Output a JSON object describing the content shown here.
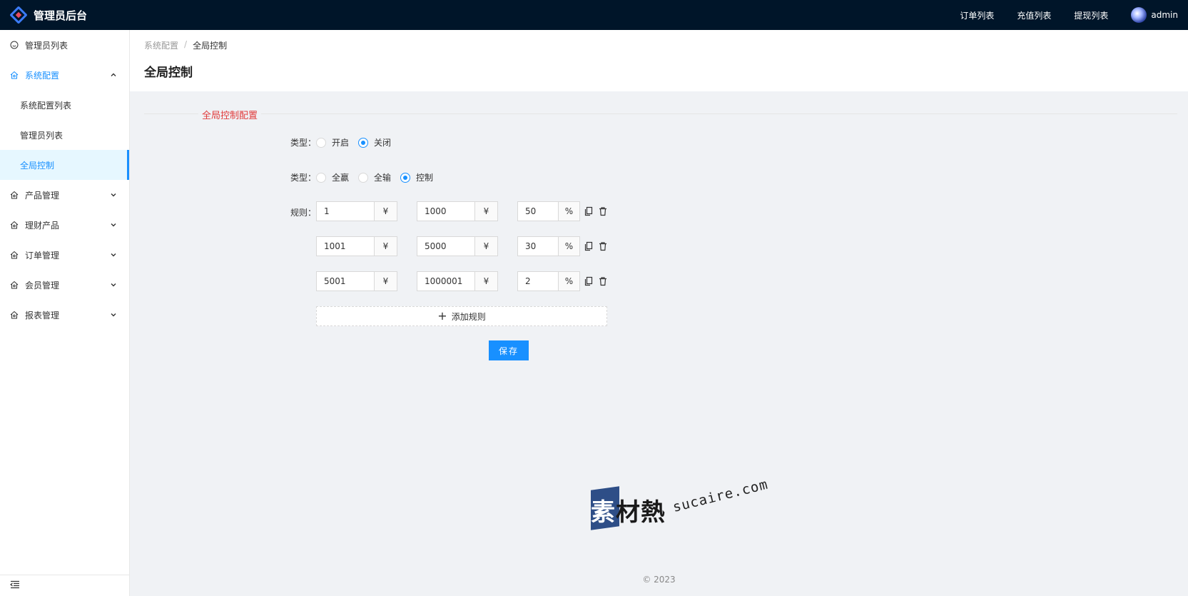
{
  "header": {
    "title": "管理员后台",
    "nav": [
      "订单列表",
      "充值列表",
      "提现列表"
    ],
    "user": "admin",
    "accent": "#001529"
  },
  "sidebar": {
    "items": [
      {
        "label": "管理员列表",
        "icon": "smile-icon"
      },
      {
        "label": "系统配置",
        "icon": "home-icon",
        "open": true,
        "children": [
          {
            "label": "系统配置列表"
          },
          {
            "label": "管理员列表"
          },
          {
            "label": "全局控制",
            "active": true
          }
        ]
      },
      {
        "label": "产品管理",
        "icon": "home-icon"
      },
      {
        "label": "理财产品",
        "icon": "home-icon"
      },
      {
        "label": "订单管理",
        "icon": "home-icon"
      },
      {
        "label": "会员管理",
        "icon": "home-icon"
      },
      {
        "label": "报表管理",
        "icon": "home-icon"
      }
    ],
    "active_color": "#1890ff"
  },
  "page": {
    "breadcrumb": [
      "系统配置",
      "/",
      "全局控制"
    ],
    "title": "全局控制"
  },
  "form": {
    "section_title": "全局控制配置",
    "type1": {
      "label": "类型：",
      "options": [
        "开启",
        "关闭"
      ],
      "selected": "关闭"
    },
    "type2": {
      "label": "类型：",
      "options": [
        "全赢",
        "全输",
        "控制"
      ],
      "selected": "控制"
    },
    "rules_label": "规则：",
    "rules": [
      {
        "min": "1",
        "max": "1000",
        "pct": "50"
      },
      {
        "min": "1001",
        "max": "5000",
        "pct": "30"
      },
      {
        "min": "5001",
        "max": "1000001",
        "pct": "2"
      }
    ],
    "currency": "¥",
    "percent": "%",
    "add_rule": "添加规则",
    "save": "保存"
  },
  "watermark": {
    "cn": "素材熱",
    "en": "sucaire.com"
  },
  "footer": "© 2023"
}
